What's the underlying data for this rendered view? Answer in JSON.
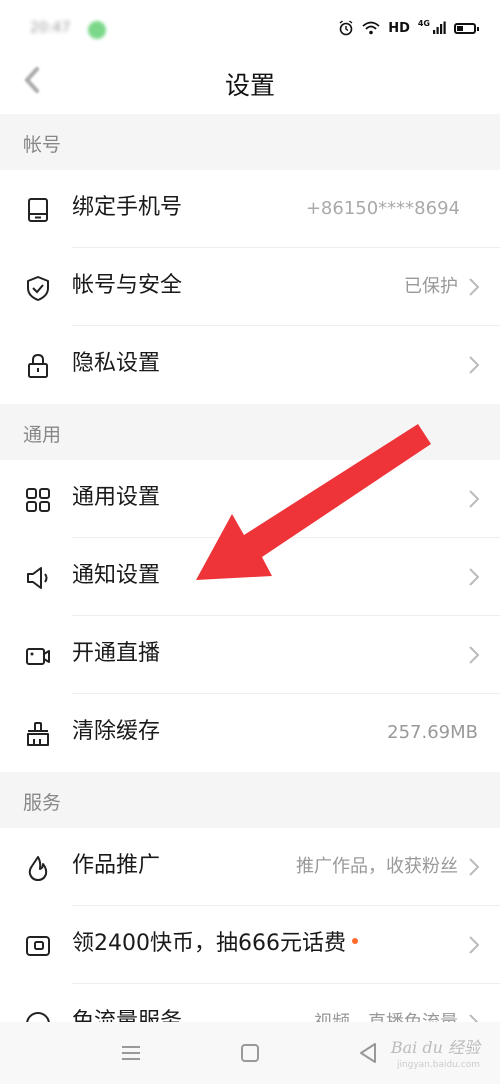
{
  "status_bar": {
    "time": "20:47",
    "network_label": "HD",
    "signal_label": "4G"
  },
  "nav": {
    "title": "设置"
  },
  "sections": {
    "account": {
      "header": "帐号",
      "items": [
        {
          "label": "绑定手机号",
          "value": "+86150****8694",
          "icon": "phone-icon"
        },
        {
          "label": "帐号与安全",
          "value": "已保护",
          "icon": "shield-icon"
        },
        {
          "label": "隐私设置",
          "value": "",
          "icon": "lock-icon"
        }
      ]
    },
    "general": {
      "header": "通用",
      "items": [
        {
          "label": "通用设置",
          "value": "",
          "icon": "grid-icon"
        },
        {
          "label": "通知设置",
          "value": "",
          "icon": "speaker-icon"
        },
        {
          "label": "开通直播",
          "value": "",
          "icon": "camera-icon"
        },
        {
          "label": "清除缓存",
          "value": "257.69MB",
          "icon": "broom-icon"
        }
      ]
    },
    "service": {
      "header": "服务",
      "items": [
        {
          "label": "作品推广",
          "value": "推广作品，收获粉丝",
          "icon": "flame-icon"
        },
        {
          "label": "领2400快币，抽666元话费",
          "value": "",
          "icon": "coin-card-icon"
        },
        {
          "label": "免流量服务",
          "value": "视频、直播免流量",
          "icon": "data-icon"
        }
      ]
    }
  },
  "watermark": {
    "brand": "Bai du 经验",
    "url": "jingyan.baidu.com"
  },
  "colors": {
    "section_bg": "#f5f5f5",
    "annotation_arrow": "#ee3438",
    "badge": "#ff6a2c"
  }
}
